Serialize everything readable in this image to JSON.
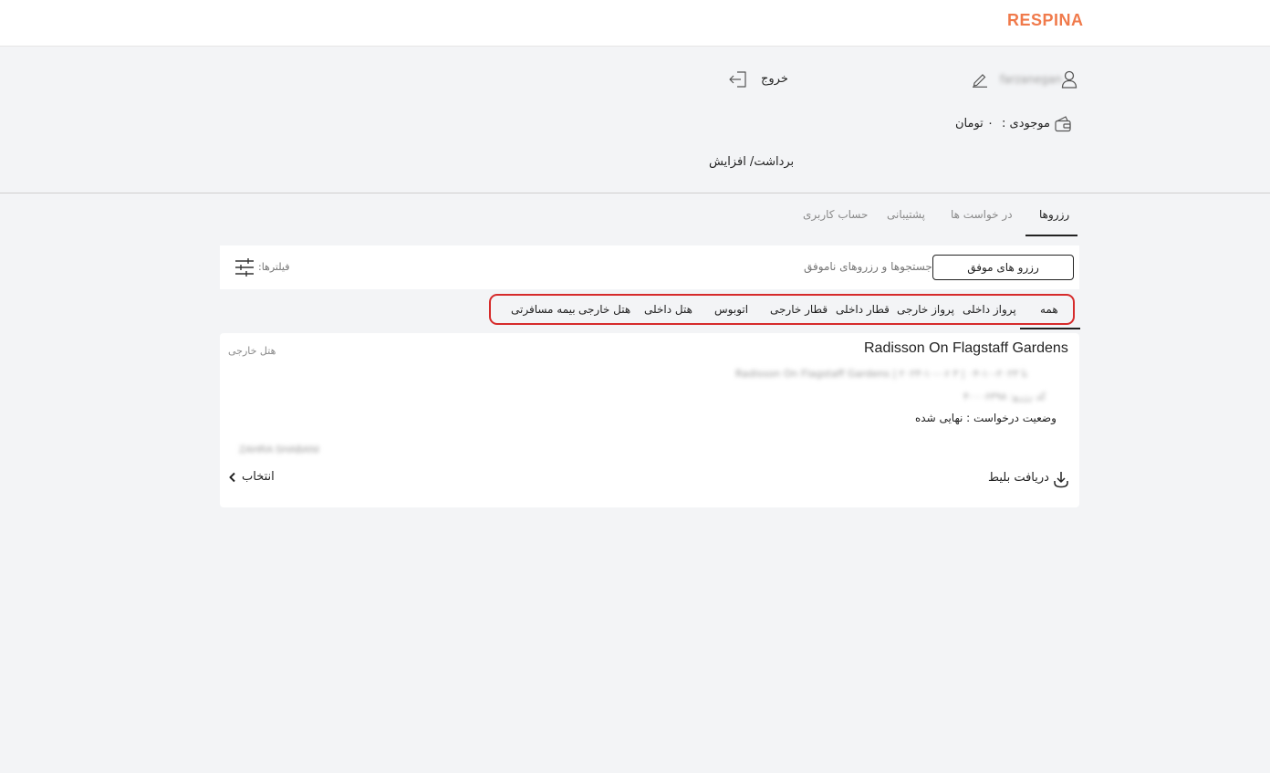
{
  "header": {
    "logo": "RESPINA"
  },
  "profile": {
    "username": "farzanegan",
    "logout_label": "خروج",
    "balance_label": "موجودی :",
    "balance_value": "۰ تومان",
    "withdraw_label": "برداشت/ افزایش"
  },
  "tabs": [
    {
      "label": "رزروها",
      "active": true
    },
    {
      "label": "در خواست ها",
      "active": false
    },
    {
      "label": "پشتیبانی",
      "active": false
    },
    {
      "label": "حساب کاربری",
      "active": false
    }
  ],
  "filter_bar": {
    "success_label": "رزرو های موفق",
    "failed_label": "جستجوها و رزروهای ناموفق",
    "filters_label": "فیلترها:"
  },
  "categories": [
    {
      "label": "همه",
      "active": true
    },
    {
      "label": "پرواز داخلی"
    },
    {
      "label": "پرواز خارجی"
    },
    {
      "label": "قطار داخلی"
    },
    {
      "label": "قطار خارجی"
    },
    {
      "label": "اتوبوس"
    },
    {
      "label": "هتل داخلی"
    },
    {
      "label": "هتل خارجی"
    },
    {
      "label": "بیمه مسافرتی"
    }
  ],
  "reservation": {
    "title": "Radisson On Flagstaff Gardens",
    "type": "هتل خارجی",
    "detail_line": "Radisson On Flagstaff Gardens | ۲۰۲۳-۱۰-۰۶ تا ۲۰۲۳-۱۰-۰۴ | ۳",
    "reserve_code": "کد رزرو: ۴۰۰۰۶۳۹۸",
    "status": "وضعیت درخواست : نهایی شده",
    "passenger": "ZAHRA SHABANI",
    "ticket_label": "دریافت بلیط",
    "select_label": "انتخاب"
  },
  "colors": {
    "accent": "#f07a4b",
    "highlight": "#d62b2b"
  }
}
